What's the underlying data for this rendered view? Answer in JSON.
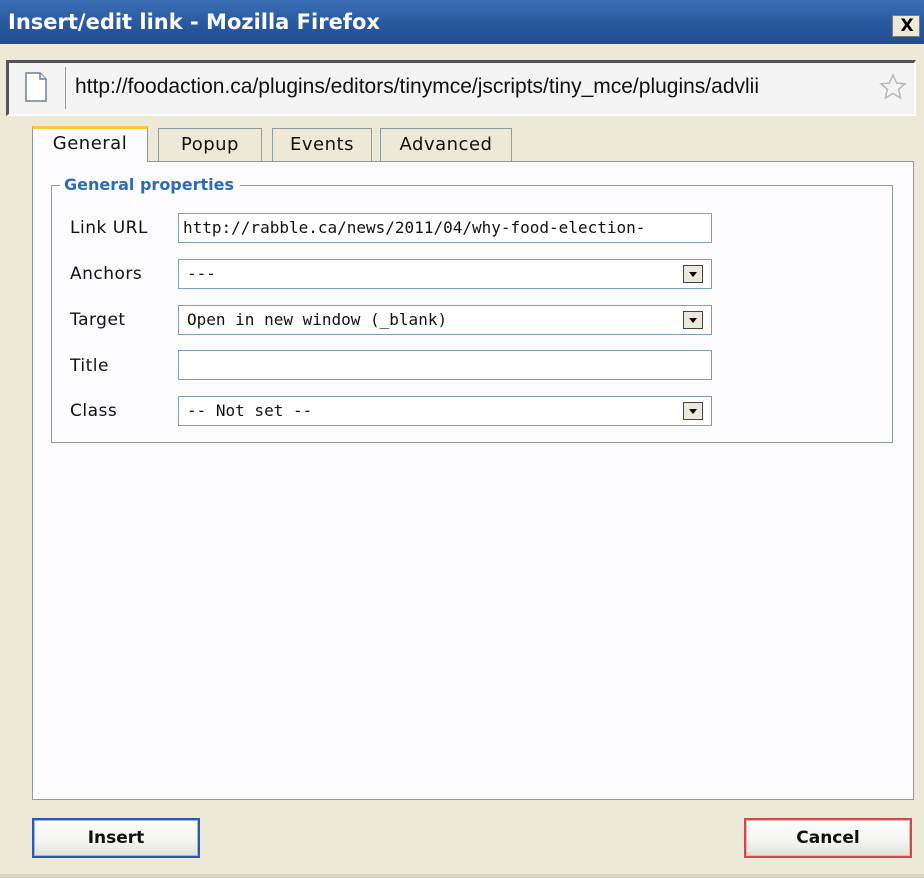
{
  "window": {
    "title": "Insert/edit link - Mozilla Firefox",
    "close_glyph": "X"
  },
  "addressbar": {
    "url": "http://foodaction.ca/plugins/editors/tinymce/jscripts/tiny_mce/plugins/advlii"
  },
  "tabs": [
    {
      "label": "General",
      "active": true
    },
    {
      "label": "Popup",
      "active": false
    },
    {
      "label": "Events",
      "active": false
    },
    {
      "label": "Advanced",
      "active": false
    }
  ],
  "general": {
    "legend": "General properties",
    "link_url_label": "Link URL",
    "link_url_value": "http://rabble.ca/news/2011/04/why-food-election-",
    "anchors_label": "Anchors",
    "anchors_value": "---",
    "target_label": "Target",
    "target_value": "Open in new window (_blank)",
    "title_label": "Title",
    "title_value": "",
    "class_label": "Class",
    "class_value": "-- Not set --"
  },
  "buttons": {
    "insert": "Insert",
    "cancel": "Cancel"
  },
  "colors": {
    "titlebar": "#2a5aa0",
    "legend": "#2b6cb5",
    "active_tab_accent": "#ffc83c",
    "insert_border": "#2b59b8",
    "cancel_border": "#cf4a4a"
  },
  "icons": {
    "page": "page-icon",
    "bookmark": "star-icon",
    "close": "close-icon",
    "dropdown": "chevron-down-icon"
  }
}
